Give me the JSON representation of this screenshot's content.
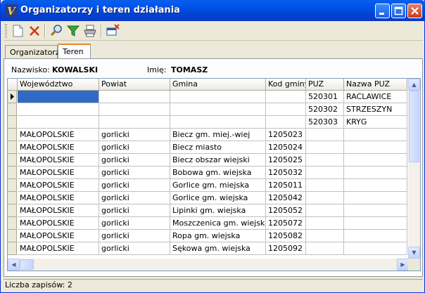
{
  "window": {
    "title": "Organizatorzy i teren działania",
    "app_icon_letter": "V"
  },
  "tabs": [
    {
      "label": "Organizatorzy"
    },
    {
      "label": "Teren"
    }
  ],
  "person": {
    "surname_label": "Nazwisko:",
    "surname": "KOWALSKI",
    "name_label": "Imię:",
    "name": "TOMASZ"
  },
  "grid": {
    "columns": [
      "Województwo",
      "Powiat",
      "Gmina",
      "Kod gminy",
      "PUZ",
      "Nazwa PUZ"
    ],
    "rows": [
      [
        "",
        "",
        "",
        "",
        "520301",
        "RACLAWICE"
      ],
      [
        "",
        "",
        "",
        "",
        "520302",
        "STRZESZYN"
      ],
      [
        "",
        "",
        "",
        "",
        "520303",
        "KRYG"
      ],
      [
        "MAŁOPOLSKIE",
        "gorlicki",
        "Biecz gm. miej.-wiej",
        "1205023",
        "",
        ""
      ],
      [
        "MAŁOPOLSKIE",
        "gorlicki",
        "Biecz miasto",
        "1205024",
        "",
        ""
      ],
      [
        "MAŁOPOLSKIE",
        "gorlicki",
        "Biecz obszar wiejski",
        "1205025",
        "",
        ""
      ],
      [
        "MAŁOPOLSKIE",
        "gorlicki",
        "Bobowa gm. wiejska",
        "1205032",
        "",
        ""
      ],
      [
        "MAŁOPOLSKIE",
        "gorlicki",
        "Gorlice gm. miejska",
        "1205011",
        "",
        ""
      ],
      [
        "MAŁOPOLSKIE",
        "gorlicki",
        "Gorlice gm. wiejska",
        "1205042",
        "",
        ""
      ],
      [
        "MAŁOPOLSKIE",
        "gorlicki",
        "Lipinki gm. wiejska",
        "1205052",
        "",
        ""
      ],
      [
        "MAŁOPOLSKIE",
        "gorlicki",
        "Moszczenica gm. wiejska",
        "1205072",
        "",
        ""
      ],
      [
        "MAŁOPOLSKIE",
        "gorlicki",
        "Ropa gm. wiejska",
        "1205082",
        "",
        ""
      ],
      [
        "MAŁOPOLSKIE",
        "gorlicki",
        "Sękowa gm. wiejska",
        "1205092",
        "",
        ""
      ]
    ]
  },
  "status": {
    "text": "Liczba zapisów: 2"
  }
}
